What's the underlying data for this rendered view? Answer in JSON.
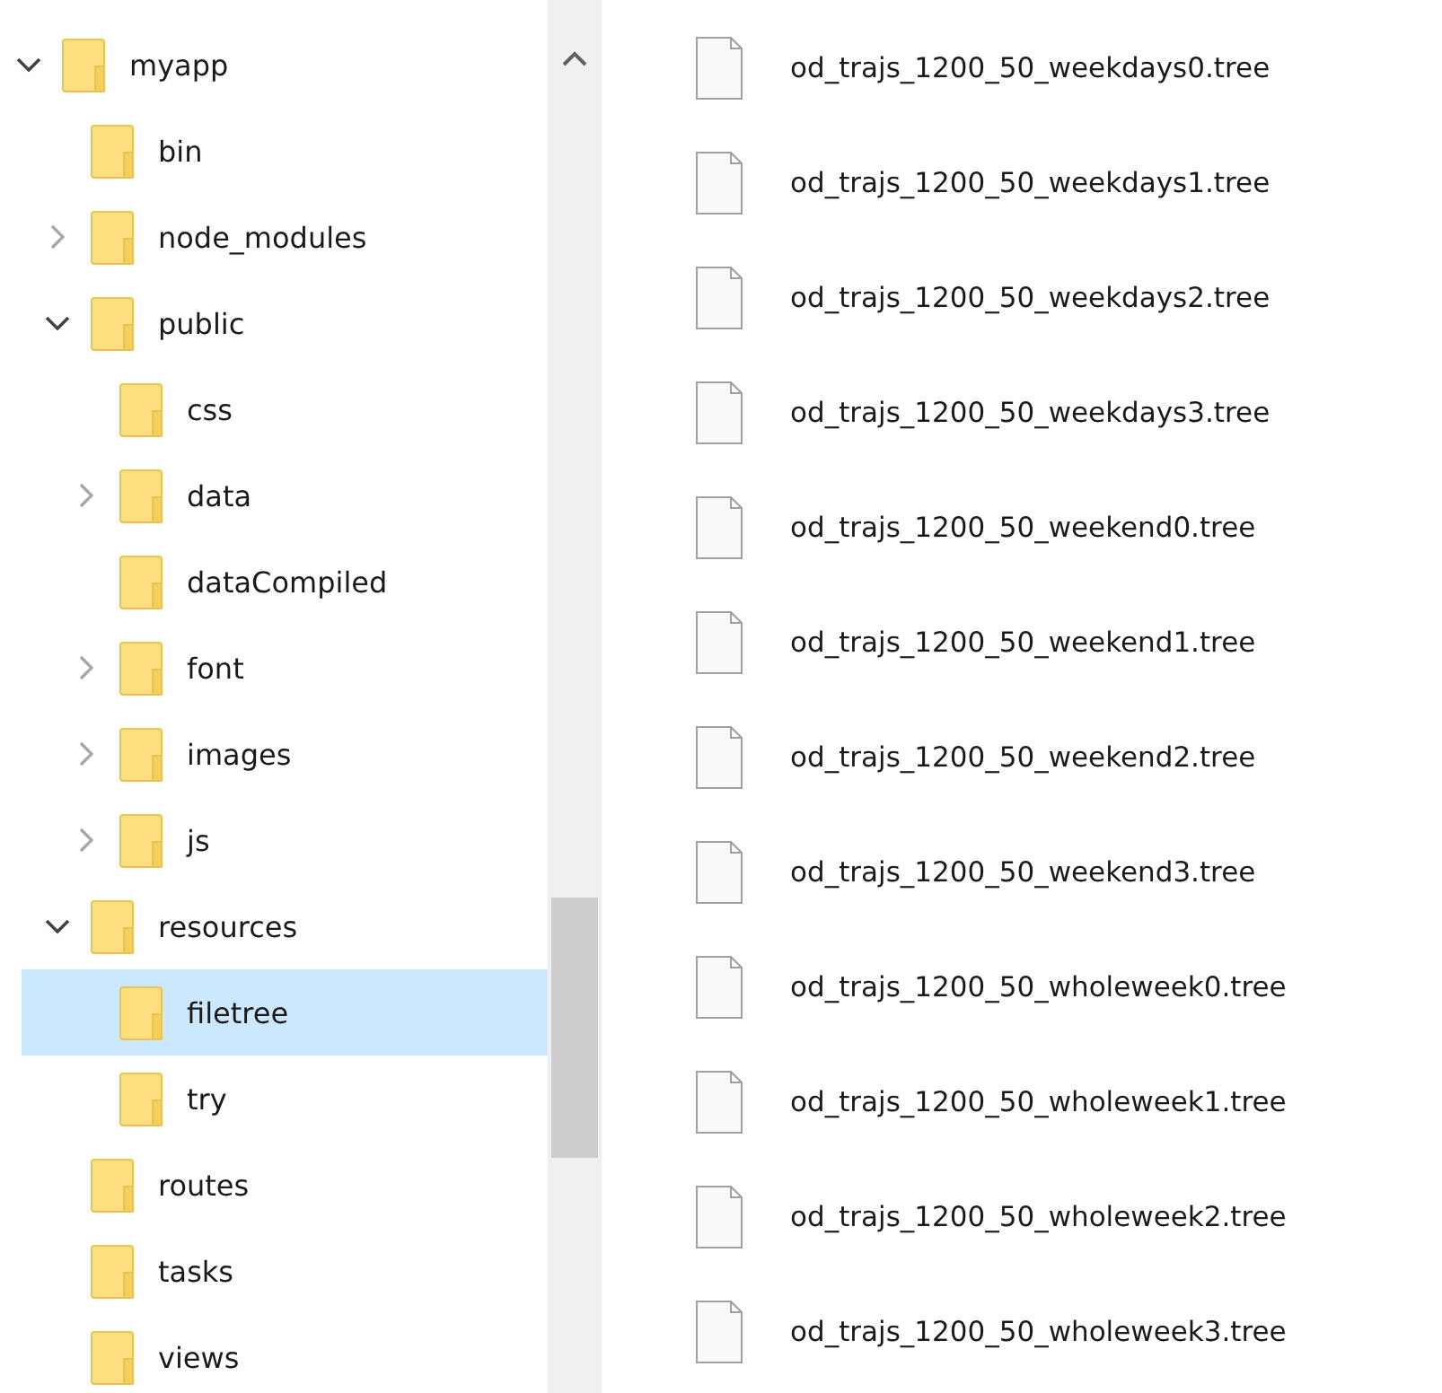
{
  "tree": [
    {
      "label": "myapp",
      "expanded": true,
      "selected": false,
      "children": [
        {
          "label": "bin",
          "selected": false
        },
        {
          "label": "node_modules",
          "expanded": false,
          "selected": false
        },
        {
          "label": "public",
          "expanded": true,
          "selected": false,
          "children": [
            {
              "label": "css",
              "selected": false
            },
            {
              "label": "data",
              "expanded": false,
              "selected": false
            },
            {
              "label": "dataCompiled",
              "selected": false
            },
            {
              "label": "font",
              "expanded": false,
              "selected": false
            },
            {
              "label": "images",
              "expanded": false,
              "selected": false
            },
            {
              "label": "js",
              "expanded": false,
              "selected": false
            }
          ]
        },
        {
          "label": "resources",
          "expanded": true,
          "selected": false,
          "children": [
            {
              "label": "filetree",
              "selected": true
            },
            {
              "label": "try",
              "selected": false
            }
          ]
        },
        {
          "label": "routes",
          "selected": false
        },
        {
          "label": "tasks",
          "selected": false
        },
        {
          "label": "views",
          "selected": false
        }
      ]
    }
  ],
  "files": [
    {
      "name": "od_trajs_1200_50_weekdays0.tree"
    },
    {
      "name": "od_trajs_1200_50_weekdays1.tree"
    },
    {
      "name": "od_trajs_1200_50_weekdays2.tree"
    },
    {
      "name": "od_trajs_1200_50_weekdays3.tree"
    },
    {
      "name": "od_trajs_1200_50_weekend0.tree"
    },
    {
      "name": "od_trajs_1200_50_weekend1.tree"
    },
    {
      "name": "od_trajs_1200_50_weekend2.tree"
    },
    {
      "name": "od_trajs_1200_50_weekend3.tree"
    },
    {
      "name": "od_trajs_1200_50_wholeweek0.tree"
    },
    {
      "name": "od_trajs_1200_50_wholeweek1.tree"
    },
    {
      "name": "od_trajs_1200_50_wholeweek2.tree"
    },
    {
      "name": "od_trajs_1200_50_wholeweek3.tree"
    }
  ]
}
